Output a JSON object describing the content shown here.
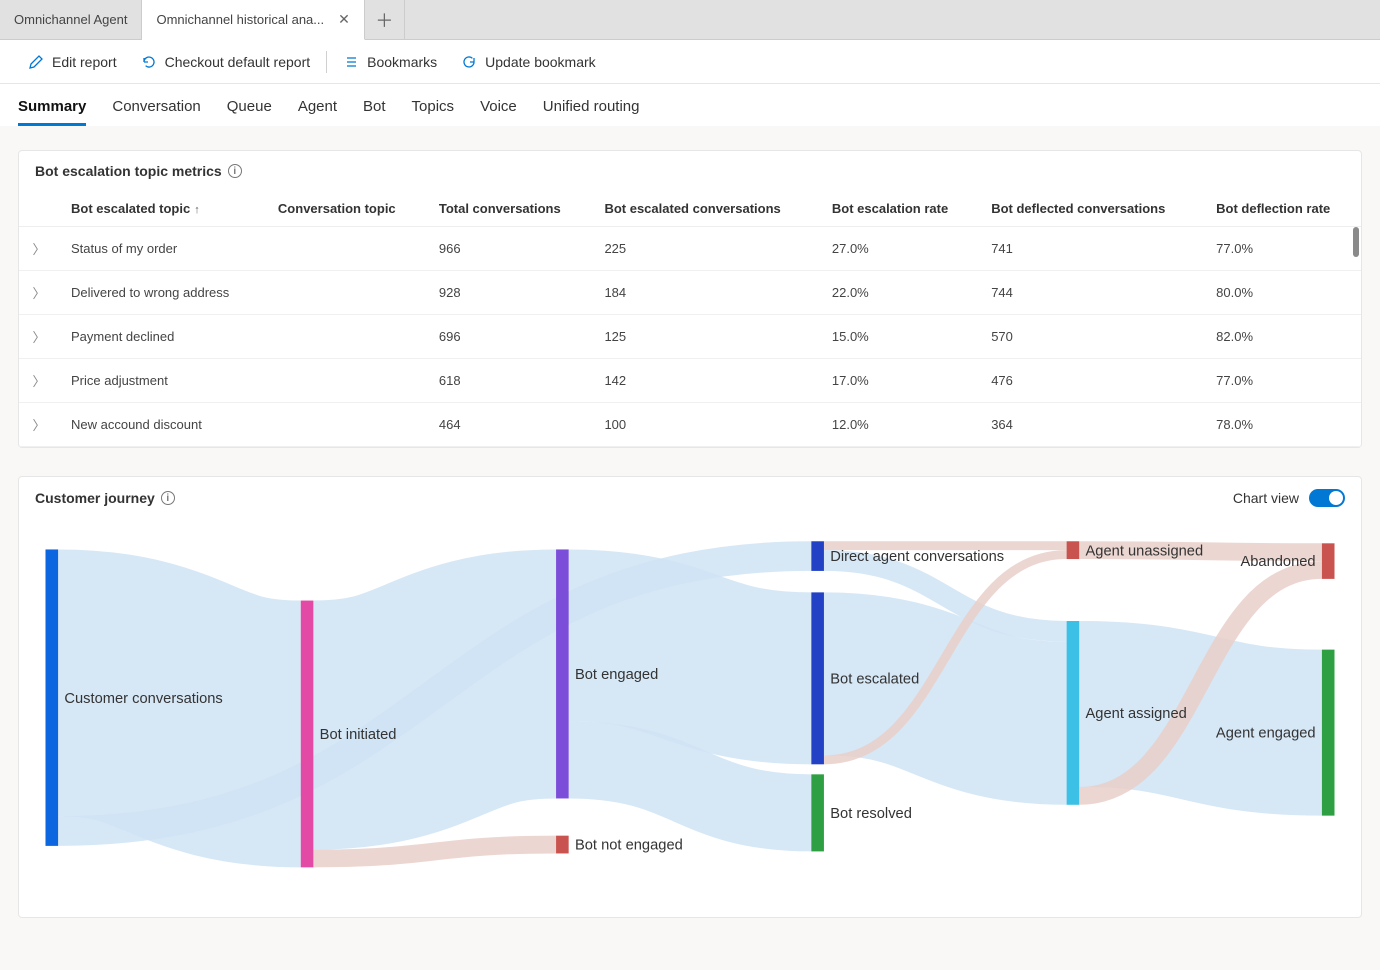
{
  "tabs": {
    "background": "Omnichannel Agent",
    "active": "Omnichannel historical ana..."
  },
  "commands": {
    "edit": "Edit report",
    "checkout": "Checkout default report",
    "bookmarks": "Bookmarks",
    "update": "Update bookmark"
  },
  "report_nav": [
    "Summary",
    "Conversation",
    "Queue",
    "Agent",
    "Bot",
    "Topics",
    "Voice",
    "Unified routing"
  ],
  "active_report_tab": "Summary",
  "table_card": {
    "title": "Bot escalation topic metrics",
    "columns": [
      "Bot escalated topic",
      "Conversation topic",
      "Total conversations",
      "Bot escalated conversations",
      "Bot escalation rate",
      "Bot deflected conversations",
      "Bot deflection rate"
    ],
    "sort_col_index": 0,
    "rows": [
      {
        "topic": "Status of my order",
        "conv_topic": "",
        "total": "966",
        "escalated": "225",
        "esc_rate": "27.0%",
        "deflected": "741",
        "def_rate": "77.0%"
      },
      {
        "topic": "Delivered to wrong address",
        "conv_topic": "",
        "total": "928",
        "escalated": "184",
        "esc_rate": "22.0%",
        "deflected": "744",
        "def_rate": "80.0%"
      },
      {
        "topic": "Payment declined",
        "conv_topic": "",
        "total": "696",
        "escalated": "125",
        "esc_rate": "15.0%",
        "deflected": "570",
        "def_rate": "82.0%"
      },
      {
        "topic": "Price adjustment",
        "conv_topic": "",
        "total": "618",
        "escalated": "142",
        "esc_rate": "17.0%",
        "deflected": "476",
        "def_rate": "77.0%"
      },
      {
        "topic": "New accound discount",
        "conv_topic": "",
        "total": "464",
        "escalated": "100",
        "esc_rate": "12.0%",
        "deflected": "364",
        "def_rate": "78.0%"
      }
    ]
  },
  "journey_card": {
    "title": "Customer journey",
    "toggle_label": "Chart view",
    "toggle_on": true
  },
  "chart_data": {
    "type": "sankey",
    "title": "Customer journey",
    "nodes": [
      {
        "id": "customer",
        "label": "Customer conversations",
        "stage": 0,
        "color": "#0b66e0"
      },
      {
        "id": "botinit",
        "label": "Bot initiated",
        "stage": 1,
        "color": "#e34aa6"
      },
      {
        "id": "botengaged",
        "label": "Bot engaged",
        "stage": 2,
        "color": "#7b4dd9"
      },
      {
        "id": "botnoteng",
        "label": "Bot not engaged",
        "stage": 2,
        "color": "#c9534f"
      },
      {
        "id": "direct",
        "label": "Direct agent conversations",
        "stage": 3,
        "color": "#2241c4"
      },
      {
        "id": "botesc",
        "label": "Bot escalated",
        "stage": 3,
        "color": "#2241c4"
      },
      {
        "id": "botres",
        "label": "Bot resolved",
        "stage": 3,
        "color": "#2ea043"
      },
      {
        "id": "agentun",
        "label": "Agent unassigned",
        "stage": 4,
        "color": "#c9534f"
      },
      {
        "id": "agentas",
        "label": "Agent assigned",
        "stage": 4,
        "color": "#3cc0e5"
      },
      {
        "id": "abandoned",
        "label": "Abandoned",
        "stage": 5,
        "color": "#c9534f"
      },
      {
        "id": "agenteng",
        "label": "Agent engaged",
        "stage": 5,
        "color": "#2ea043"
      }
    ],
    "links": [
      {
        "source": "customer",
        "target": "botinit",
        "value": 90,
        "tone": "blue"
      },
      {
        "source": "customer",
        "target": "direct",
        "value": 10,
        "tone": "blue"
      },
      {
        "source": "botinit",
        "target": "botengaged",
        "value": 84,
        "tone": "blue"
      },
      {
        "source": "botinit",
        "target": "botnoteng",
        "value": 6,
        "tone": "red"
      },
      {
        "source": "botengaged",
        "target": "botesc",
        "value": 58,
        "tone": "blue"
      },
      {
        "source": "botengaged",
        "target": "botres",
        "value": 26,
        "tone": "blue"
      },
      {
        "source": "direct",
        "target": "agentun",
        "value": 3,
        "tone": "red"
      },
      {
        "source": "direct",
        "target": "agentas",
        "value": 7,
        "tone": "blue"
      },
      {
        "source": "botesc",
        "target": "agentas",
        "value": 55,
        "tone": "blue"
      },
      {
        "source": "botesc",
        "target": "agentun",
        "value": 3,
        "tone": "red"
      },
      {
        "source": "agentun",
        "target": "abandoned",
        "value": 6,
        "tone": "red"
      },
      {
        "source": "agentas",
        "target": "agenteng",
        "value": 56,
        "tone": "blue"
      },
      {
        "source": "agentas",
        "target": "abandoned",
        "value": 6,
        "tone": "red"
      }
    ]
  }
}
